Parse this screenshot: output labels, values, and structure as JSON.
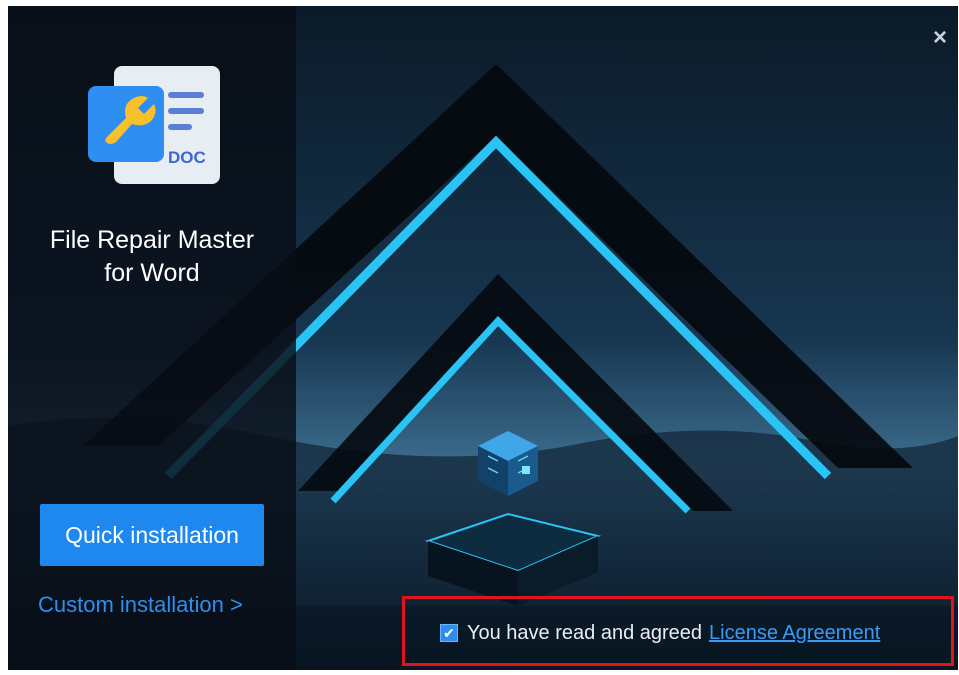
{
  "app": {
    "title_line1": "File Repair Master",
    "title_line2": "for Word",
    "logo_badge": "DOC"
  },
  "actions": {
    "quick_install_label": "Quick installation",
    "custom_install_label": "Custom installation >"
  },
  "agreement": {
    "checked": true,
    "text": "You have read and agreed",
    "link_label": "License Agreement"
  },
  "window": {
    "close_glyph": "×"
  },
  "icons": {
    "close": "close-icon",
    "logo": "doc-repair-logo-icon",
    "checkbox": "checkmark-icon"
  },
  "colors": {
    "accent": "#1e88f0",
    "link": "#2d8ef0",
    "highlight_border": "#e0141c",
    "neon": "#29c4f5"
  }
}
